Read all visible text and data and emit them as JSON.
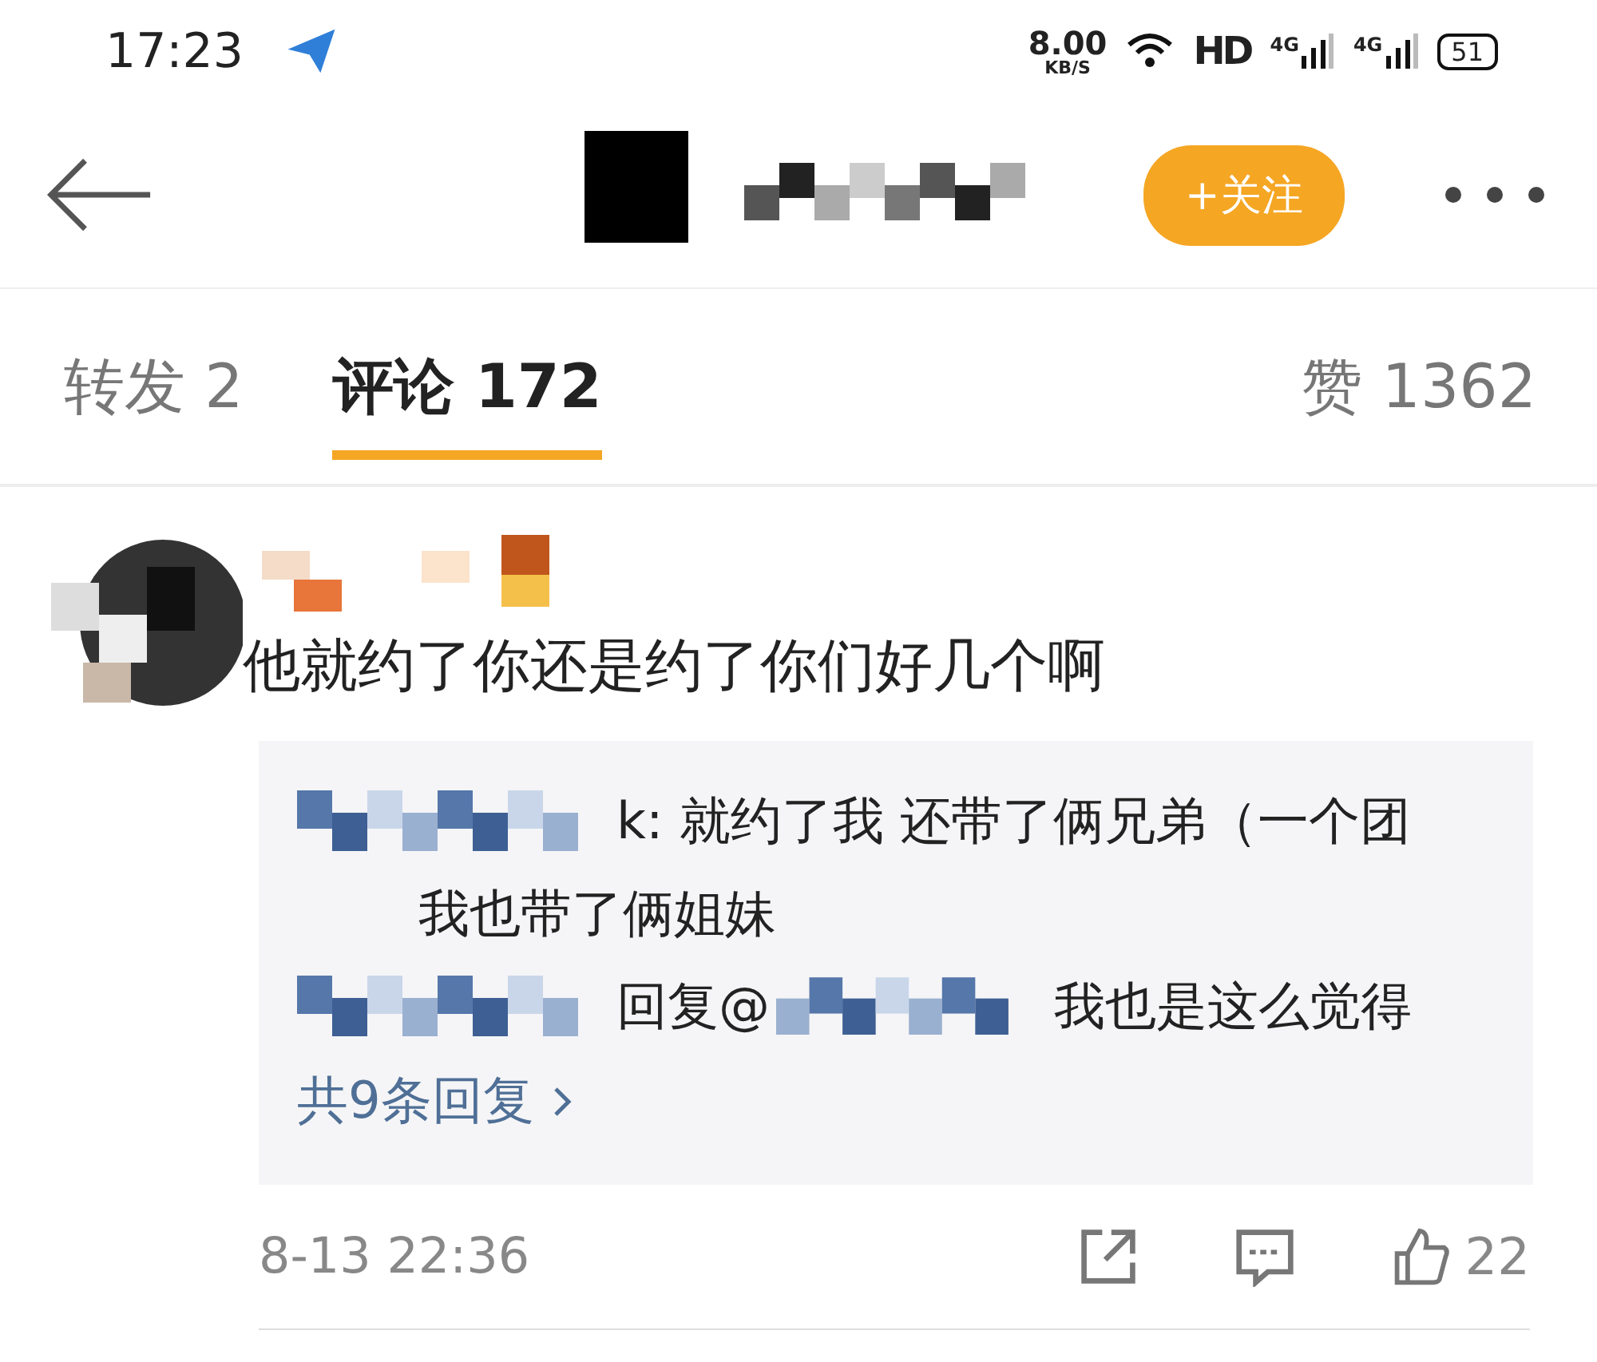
{
  "status_bar": {
    "time": "17:23",
    "speed": "8.00",
    "speed_unit": "KB/S",
    "hd": "HD",
    "networks": [
      "4G",
      "4G"
    ],
    "battery": "51"
  },
  "header": {
    "follow_button": "+关注"
  },
  "tabs": [
    {
      "label": "转发 2",
      "selected": false
    },
    {
      "label": "评论 172",
      "selected": true
    },
    {
      "label": "赞 1362",
      "selected": false
    }
  ],
  "comment": {
    "text": "他就约了你还是约了你们好几个啊",
    "replies": [
      {
        "kind": "named",
        "text": "k: 就约了我 还带了俩兄弟（一个团"
      },
      {
        "kind": "continued",
        "text": "我也带了俩姐妹"
      },
      {
        "kind": "reply_to",
        "text": "回复@",
        "text2": "我也是这么觉得"
      }
    ],
    "more": "共9条回复",
    "time": "8-13 22:36",
    "likes": "22"
  }
}
